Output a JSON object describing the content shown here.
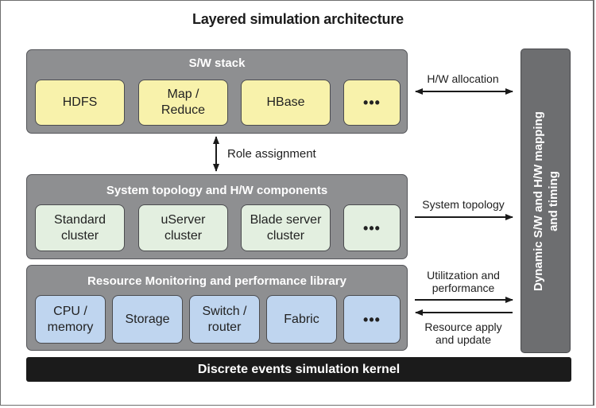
{
  "title": "Layered simulation architecture",
  "layers": {
    "sw_stack": {
      "title": "S/W stack",
      "items": [
        "HDFS",
        "Map /\nReduce",
        "HBase",
        "•••"
      ]
    },
    "topology": {
      "title": "System topology and H/W components",
      "items": [
        "Standard\ncluster",
        "uServer\ncluster",
        "Blade server\ncluster",
        "•••"
      ]
    },
    "monitoring": {
      "title": "Resource Monitoring and performance library",
      "items": [
        "CPU /\nmemory",
        "Storage",
        "Switch /\nrouter",
        "Fabric",
        "•••"
      ]
    }
  },
  "kernel": "Discrete events simulation kernel",
  "side_panel": "Dynamic S/W and H/W mapping\nand timing",
  "connectors": {
    "role_assignment": "Role assignment",
    "hw_allocation": "H/W allocation",
    "system_topology": "System topology",
    "utilization": "Utilitzation and\nperformance",
    "resource_apply": "Resource apply\nand update"
  },
  "colors": {
    "layer": "#8e8f91",
    "sw_item": "#f8f2ab",
    "hw_item": "#e3efe0",
    "monitor_item": "#bfd5ef",
    "kernel": "#1b1b1b",
    "side_panel": "#6d6e70"
  }
}
